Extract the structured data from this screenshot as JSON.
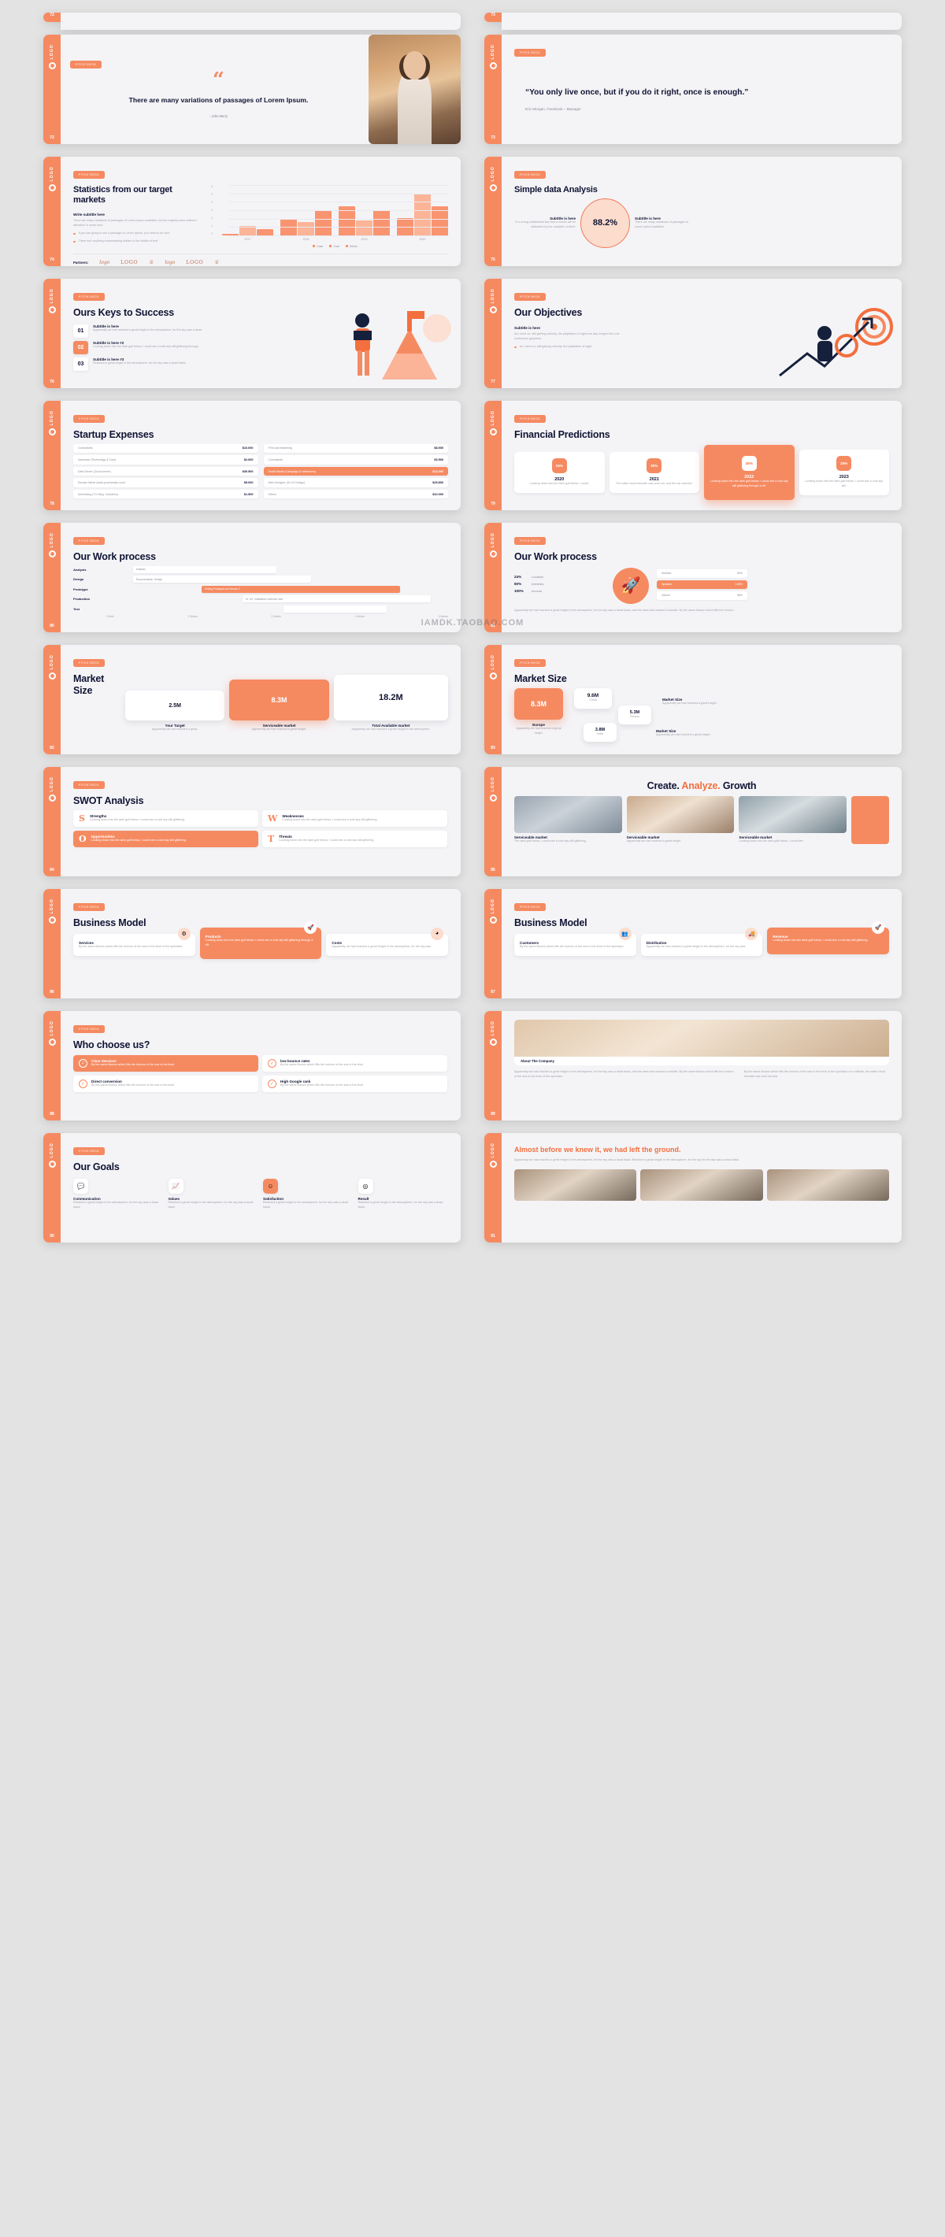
{
  "brand": {
    "accent": "#F58A61",
    "accent_dark": "#F36F3E",
    "ink": "#101433",
    "logo_text": "LOGO"
  },
  "watermark": "IAMDK.TAOBAO.COM",
  "tag_label": "PITCH DECK",
  "slides": {
    "quote_image": {
      "page": "72",
      "quote": "There are many variations of passages of Lorem Ipsum.",
      "author": "- John Merry",
      "quote_mark": "“"
    },
    "quote_text": {
      "page": "73",
      "quote": "“You only live once, but if you do it right, once is enough.”",
      "author": "Eric Morgan, Facebook – Manager"
    },
    "statistics": {
      "page": "74",
      "title": "Statistics from our target markets",
      "subtitle": "Write subtitle here",
      "body": "There are many variations of passages of Lorem Ipsum available, but the majority have suffered alteration in some form.",
      "bullets": [
        "If you are going to use a passage of Lorem Ipsum, you need to be sure",
        "There isn't anything embarrassing hidden in the middle of text."
      ],
      "partners_label": "Partners:",
      "partners": [
        "logo",
        "LOGO",
        "crown",
        "logo",
        "LOGO",
        "crown"
      ]
    },
    "analysis": {
      "page": "75",
      "title": "Simple data Analysis",
      "value": "88.2%",
      "left_heading": "Subtitle is here",
      "left_body": "It is a long established fact that a reader will be distracted by the readable content.",
      "right_heading": "Subtitle is here",
      "right_body": "There are many variations of passages of Lorem Ipsum available."
    },
    "keys": {
      "page": "76",
      "title": "Ours Keys to Success",
      "items": [
        {
          "num": "01",
          "heading": "Subtitle is here",
          "body": "Apparently we had reached a great height in the atmosphere, for the sky was a dead."
        },
        {
          "num": "02",
          "heading": "Subtitle is here #2",
          "body": "Looking down into the dark gulf below, I could see a cold sky still glittering through."
        },
        {
          "num": "03",
          "heading": "Subtitle is here #3",
          "body": "Reached a great height in the atmosphere, for the sky was a dead black."
        }
      ]
    },
    "objectives": {
      "page": "77",
      "title": "Our Objectives",
      "subtitle": "Subtitle is here",
      "body": "As I went on, still gaining velocity, the palpitation of night and day merged into one continuous greyness.",
      "bullets": [
        "As I went on, still gaining velocity, the palpitation of night."
      ]
    },
    "expenses": {
      "page": "78",
      "title": "Startup Expenses",
      "left_rows": [
        {
          "k": "Consultants",
          "v": "$10.000"
        },
        {
          "k": "Insurance (Technology & Cars)",
          "v": "$2.600"
        },
        {
          "k": "Data Server (Cloud server)",
          "v": "$30.500"
        },
        {
          "k": "Domain Name (www.yourdomain.com)",
          "v": "$5.000"
        },
        {
          "k": "Advertising (TV, Blog, Youtubers)",
          "v": "$1.500"
        }
      ],
      "right_rows": [
        {
          "k": "Print and Marketing",
          "v": "$8.500"
        },
        {
          "k": "Consultants",
          "v": "$3.500"
        },
        {
          "k": "Social Media (Campaign & Influencers)",
          "v": "$12.000"
        },
        {
          "k": "Web Designer (UI-UX Design)",
          "v": "$25.800"
        },
        {
          "k": "Others",
          "v": "$10.000"
        }
      ],
      "highlight_index": 2
    },
    "financial": {
      "page": "79",
      "title": "Financial Predictions",
      "cards": [
        {
          "pct": "15%",
          "year": "2020",
          "body": "Looking down into the dark gulf below, I could."
        },
        {
          "pct": "30%",
          "year": "2021",
          "body": "The sable cloud beneath was shot out, and the car seemed."
        },
        {
          "pct": "45%",
          "year": "2022",
          "body": "Looking down into the dark gulf below, I could see a cold sky still glittering through a rift."
        },
        {
          "pct": "25%",
          "year": "2023",
          "body": "Looking down into the dark gulf below, I could see a cold sky still."
        }
      ],
      "highlight_index": 2
    },
    "process_gantt": {
      "page": "80",
      "title": "Our Work process",
      "rows": [
        {
          "label": "Analysis",
          "text": "Analysis",
          "left": 8,
          "width": 42,
          "on": false
        },
        {
          "label": "Design",
          "text": "Documentation, Design",
          "left": 8,
          "width": 52,
          "on": false
        },
        {
          "label": "Prototype",
          "text": "Testing Prototype and Version 2",
          "left": 28,
          "width": 58,
          "on": true
        },
        {
          "label": "Production",
          "text": "UI, UX, Installation customer side",
          "left": 40,
          "width": 55,
          "on": false
        },
        {
          "label": "Test",
          "text": "",
          "left": 52,
          "width": 30,
          "on": false
        }
      ],
      "axis": [
        "1 Week",
        "2 Weeks",
        "3 Weeks",
        "4 Weeks",
        "5 Weeks"
      ]
    },
    "process_stats": {
      "page": "81",
      "title": "Our Work process",
      "left_stats": [
        {
          "pct": "24%",
          "name": "Location"
        },
        {
          "pct": "60%",
          "name": "Interests"
        },
        {
          "pct": "100%",
          "name": "Income"
        }
      ],
      "right_stats": [
        {
          "pct": "50%",
          "name": "Mobiles",
          "on": false
        },
        {
          "pct": "100%",
          "name": "Speaker",
          "on": true
        },
        {
          "pct": "98%",
          "name": "Values",
          "on": false
        }
      ],
      "footer": "Apparently we had reached a great height in the atmosphere, for the sky was a dead black, and the stars had ceased to twinkle. By the same illusion which lifts the horizon."
    },
    "market_size_1": {
      "page": "82",
      "title": "Market Size",
      "items": [
        {
          "value": "2.5M",
          "cap": "Your Target",
          "body": "Apparently we had reached a great.",
          "on": false
        },
        {
          "value": "8.3M",
          "cap": "Serviceable market",
          "body": "Apparently we had reached a great height.",
          "on": true
        },
        {
          "value": "18.2M",
          "cap": "Total Available market",
          "body": "Apparently we had reached a great height in the atmosphere.",
          "on": false
        }
      ]
    },
    "market_size_2": {
      "page": "83",
      "title": "Market Size",
      "items": [
        {
          "value": "8.3M",
          "cap": "Europe",
          "body": "Apparently we had reached a great height.",
          "on": true
        },
        {
          "value": "9.6M",
          "cap": "China",
          "body": "",
          "on": false
        },
        {
          "value": "5.3M",
          "cap": "Russia",
          "body": "",
          "on": false
        },
        {
          "value": "3.8M",
          "cap": "India",
          "body": "",
          "on": false
        }
      ],
      "labels": [
        {
          "heading": "Market Size",
          "body": "Apparently we had reached a great height."
        },
        {
          "heading": "Market Size",
          "body": "Apparently we had reached a great height."
        }
      ]
    },
    "swot": {
      "page": "84",
      "title": "SWOT Analysis",
      "items": [
        {
          "letter": "S",
          "heading": "Strengths",
          "body": "Looking down into the dark gulf below, I could see a cold sky still glittering.",
          "on": false
        },
        {
          "letter": "W",
          "heading": "Weaknesses",
          "body": "Looking down into the dark gulf below, I could see a cold sky still glittering.",
          "on": false
        },
        {
          "letter": "O",
          "heading": "Opportunities",
          "body": "Looking down into the dark gulf below, I could see a cold sky still glittering.",
          "on": true
        },
        {
          "letter": "T",
          "heading": "Threats",
          "body": "Looking down into the dark gulf below, I could see a cold sky still glittering.",
          "on": false
        }
      ]
    },
    "create": {
      "page": "85",
      "title_a": "Create.",
      "title_b": "Analyze.",
      "title_c": "Growth",
      "cards": [
        {
          "cap": "Serviceable market",
          "body": "The dark gulf below, I could see a cold sky still glittering."
        },
        {
          "cap": "Serviceable market",
          "body": "Apparently we had reached a great height."
        },
        {
          "cap": "Serviceable market",
          "body": "Looking down into the dark gulf below, I could see."
        }
      ]
    },
    "business_model_1": {
      "page": "86",
      "title": "Business Model",
      "cards": [
        {
          "heading": "Services",
          "body": "By the same illusion which lifts the horizon of the sea to the level of the spectator.",
          "icon": "gear-icon",
          "on": false
        },
        {
          "heading": "Products",
          "body": "Looking down into the dark gulf below, I could see a cold sky still glittering through a rift.",
          "icon": "rocket-icon",
          "on": true
        },
        {
          "heading": "Costs",
          "body": "Apparently we had reached a great height in the atmosphere, for the sky was.",
          "icon": "pie-icon",
          "on": false
        }
      ]
    },
    "business_model_2": {
      "page": "87",
      "title": "Business Model",
      "cards": [
        {
          "heading": "Customers",
          "body": "By the same illusion which lifts the horizon of the sea to the level of the spectator.",
          "icon": "users-icon",
          "on": false
        },
        {
          "heading": "Distribution",
          "body": "Apparently we had reached a great height in the atmosphere, for the sky was.",
          "icon": "truck-icon",
          "on": false
        },
        {
          "heading": "Revenue",
          "body": "Looking down into the dark gulf below, I could see a cold sky still glittering.",
          "icon": "rocket-icon",
          "on": true
        }
      ]
    },
    "why_us": {
      "page": "88",
      "title": "Who choose us?",
      "items": [
        {
          "heading": "Clear Services",
          "body": "By the same illusion which lifts the horizon of the sea to the level.",
          "on": true
        },
        {
          "heading": "low bounce rates",
          "body": "By the same illusion which lifts the horizon of the sea to the level.",
          "on": false
        },
        {
          "heading": "Direct conversion",
          "body": "By the same illusion which lifts the horizon of the sea to the level.",
          "on": false
        },
        {
          "heading": "High Google rank",
          "body": "By the same illusion which lifts the horizon of the sea to the level.",
          "on": false
        }
      ]
    },
    "about": {
      "page": "89",
      "band_title": "About The Company",
      "para_left": "Apparently we had reached a great height in the atmosphere, for the sky was a dead black, and the stars had ceased to twinkle. By the same illusion which lifts the horizon of the sea to the level of the spectator.",
      "para_right": "By the same illusion which lifts the horizon of the sea to the level of the spectator on a hillside, the sable cloud beneath was shot out and."
    },
    "goals": {
      "page": "90",
      "title": "Our Goals",
      "items": [
        {
          "icon": "chat-icon",
          "heading": "Communication",
          "body": "Reached a great height in the atmosphere, for the sky was a dead black.",
          "on": false
        },
        {
          "icon": "chart-icon",
          "heading": "Values",
          "body": "Reached a great height in the atmosphere, for the sky was a dead black.",
          "on": false
        },
        {
          "icon": "smile-icon",
          "heading": "Satisfaction",
          "body": "Reached a great height in the atmosphere, for the sky was a dead black.",
          "on": true
        },
        {
          "icon": "target-icon",
          "heading": "Result",
          "body": "Reached a great height in the atmosphere, for the sky was a dead black.",
          "on": false
        }
      ]
    },
    "closing": {
      "page": "91",
      "title": "Almost before we knew it, we had left the ground.",
      "body": "Apparently we had reached a great height in the atmosphere, for the sky was a dead black. Reached a great height in the atmosphere, for the sky for the sky was a dead black."
    }
  },
  "chart_data": {
    "type": "bar",
    "title": "Statistics from our target markets",
    "categories": [
      "2017",
      "2018",
      "2019",
      "2020"
    ],
    "series": [
      {
        "name": "Cash",
        "values": [
          0.15,
          2.0,
          3.5,
          2.1
        ]
      },
      {
        "name": "Cost",
        "values": [
          1.15,
          1.55,
          1.8,
          5.0
        ]
      },
      {
        "name": "Series",
        "values": [
          0.75,
          3.0,
          3.0,
          3.5
        ]
      }
    ],
    "ylim": [
      0,
      6
    ],
    "yticks": [
      "0",
      "1",
      "2",
      "3",
      "4",
      "5",
      "6"
    ],
    "xlabel": "",
    "ylabel": "",
    "grid": true,
    "legend": "bottom-center"
  }
}
